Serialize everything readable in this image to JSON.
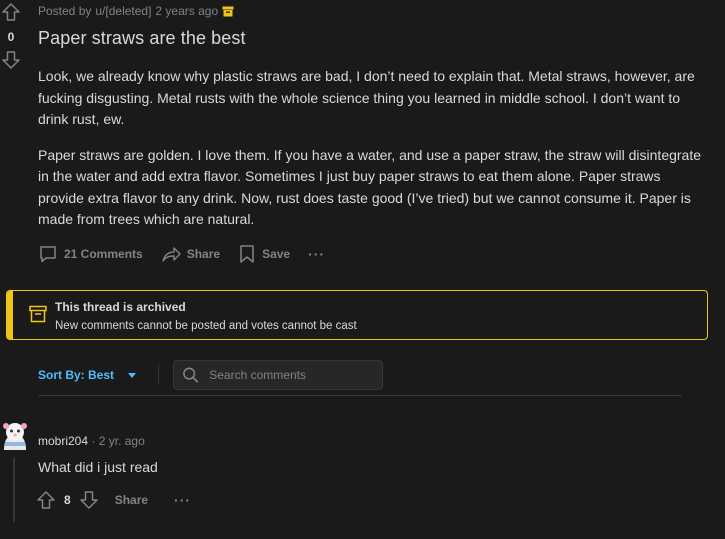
{
  "post": {
    "meta_prefix": "Posted by",
    "author": "u/[deleted]",
    "age": "2 years ago",
    "score": "0",
    "title": "Paper straws are the best",
    "paragraphs": [
      "Look, we already know why plastic straws are bad, I don’t need to explain that. Metal straws, however, are fucking disgusting. Metal rusts with the whole science thing you learned in middle school. I don’t want to drink rust, ew.",
      "Paper straws are golden. I love them. If you have a water, and use a paper straw, the straw will disintegrate in the water and add extra flavor. Sometimes I just buy paper straws to eat them alone. Paper straws provide extra flavor to any drink. Now, rust does taste good (I’ve tried) but we cannot consume it. Paper is made from trees which are natural."
    ],
    "actions": {
      "comments": "21 Comments",
      "share": "Share",
      "save": "Save",
      "more": "···"
    }
  },
  "archived": {
    "title": "This thread is archived",
    "subtitle": "New comments cannot be posted and votes cannot be cast",
    "accent": "#f0c419"
  },
  "comments_bar": {
    "sort_label": "Sort By: Best",
    "search_placeholder": "Search comments"
  },
  "comments": [
    {
      "author": "mobri204",
      "dot": "·",
      "age": "2 yr. ago",
      "text": "What did i just read",
      "score": "8",
      "share": "Share",
      "more": "···"
    }
  ],
  "colors": {
    "background": "#1a1a1b",
    "text": "#d7dadc",
    "muted": "#818384",
    "link": "#4fbcff"
  }
}
